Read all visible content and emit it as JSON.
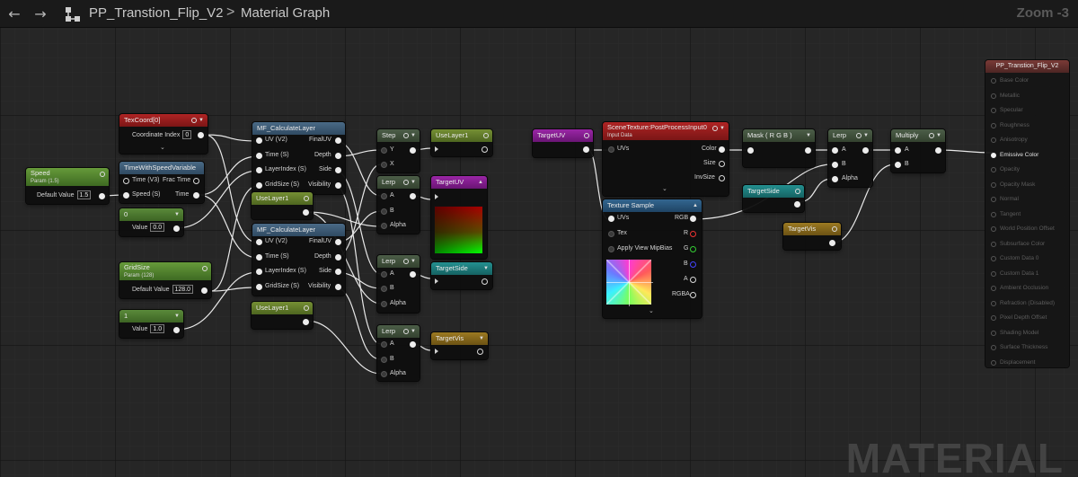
{
  "topbar": {
    "back_icon": "arrow-left-icon",
    "forward_icon": "arrow-right-icon",
    "graph_icon": "node-graph-icon",
    "asset_name": "PP_Transtion_Flip_V2",
    "separator": ">",
    "graph_name": "Material Graph",
    "zoom": "Zoom -3"
  },
  "watermark": "MATERIAL",
  "colors": {
    "texcoord_header": "#9a1e1e",
    "param_header": "#56882f",
    "function_header": "#3e5a74",
    "math_header": "#3c4d3a",
    "uselayer_header": "#5e7a2a",
    "targetuv_header": "#8a1f95",
    "scenetexture_header": "#a01e1e",
    "texturesample_header": "#2b5778",
    "targetside_header": "#1f7e7e",
    "targetvis_header": "#8a6a1c",
    "result_header": "#7a3a36"
  },
  "nodes": {
    "texcoord": {
      "title": "TexCoord[0]",
      "coord_label": "Coordinate Index",
      "coord_value": "0"
    },
    "speed": {
      "title": "Speed",
      "subtitle": "Param (1.5)",
      "default_label": "Default Value",
      "default_value": "1.5"
    },
    "timespeed": {
      "title": "TimeWithSpeedVariable",
      "in_time": "Time (V3)",
      "in_speed": "Speed (S)",
      "out_frac": "Frac Time",
      "out_time": "Time"
    },
    "const0": {
      "title": "0",
      "value_label": "Value",
      "value": "0.0"
    },
    "gridsize": {
      "title": "GridSize",
      "subtitle": "Param (128)",
      "default_label": "Default Value",
      "default_value": "128.0"
    },
    "const1": {
      "title": "1",
      "value_label": "Value",
      "value": "1.0"
    },
    "mf1": {
      "title": "MF_CalculateLayer",
      "in": [
        "UV (V2)",
        "Time (S)",
        "LayerIndex (S)",
        "GridSize (S)"
      ],
      "out": [
        "FinalUV",
        "Depth",
        "Side",
        "Visibility"
      ]
    },
    "mf2": {
      "title": "MF_CalculateLayer",
      "in": [
        "UV (V2)",
        "Time (S)",
        "LayerIndex (S)",
        "GridSize (S)"
      ],
      "out": [
        "FinalUV",
        "Depth",
        "Side",
        "Visibility"
      ]
    },
    "uselayer_a": {
      "title": "UseLayer1"
    },
    "uselayer_b": {
      "title": "UseLayer1"
    },
    "uselayer_c": {
      "title": "UseLayer1"
    },
    "step": {
      "title": "Step",
      "in": [
        "Y",
        "X"
      ]
    },
    "lerp1": {
      "title": "Lerp",
      "in": [
        "A",
        "B",
        "Alpha"
      ]
    },
    "lerp2": {
      "title": "Lerp",
      "in": [
        "A",
        "B",
        "Alpha"
      ]
    },
    "lerp3": {
      "title": "Lerp",
      "in": [
        "A",
        "B",
        "Alpha"
      ]
    },
    "targetuv_out": {
      "title": "TargetUV"
    },
    "targetside_out": {
      "title": "TargetSide"
    },
    "targetvis_out": {
      "title": "TargetVis"
    },
    "targetuv_in": {
      "title": "TargetUV"
    },
    "scenetexture": {
      "title": "SceneTexture:PostProcessInput0",
      "subtitle": "Input Data",
      "in_uvs": "UVs",
      "out": [
        "Color",
        "Size",
        "InvSize"
      ]
    },
    "texturesample": {
      "title": "Texture Sample",
      "in": [
        "UVs",
        "Tex",
        "Apply View MipBias"
      ],
      "out": [
        "RGB",
        "R",
        "G",
        "B",
        "A",
        "RGBA"
      ]
    },
    "mask": {
      "title": "Mask ( R G B )"
    },
    "lerp4": {
      "title": "Lerp",
      "in": [
        "A",
        "B",
        "Alpha"
      ]
    },
    "multiply": {
      "title": "Multiply",
      "in": [
        "A",
        "B"
      ]
    },
    "targetside_in": {
      "title": "TargetSide"
    },
    "targetvis_in": {
      "title": "TargetVis"
    }
  },
  "result": {
    "title": "PP_Transtion_Flip_V2",
    "inputs": [
      {
        "label": "Base Color",
        "active": false
      },
      {
        "label": "Metallic",
        "active": false
      },
      {
        "label": "Specular",
        "active": false
      },
      {
        "label": "Roughness",
        "active": false
      },
      {
        "label": "Anisotropy",
        "active": false
      },
      {
        "label": "Emissive Color",
        "active": true
      },
      {
        "label": "Opacity",
        "active": false
      },
      {
        "label": "Opacity Mask",
        "active": false
      },
      {
        "label": "Normal",
        "active": false
      },
      {
        "label": "Tangent",
        "active": false
      },
      {
        "label": "World Position Offset",
        "active": false
      },
      {
        "label": "Subsurface Color",
        "active": false
      },
      {
        "label": "Custom Data 0",
        "active": false
      },
      {
        "label": "Custom Data 1",
        "active": false
      },
      {
        "label": "Ambient Occlusion",
        "active": false
      },
      {
        "label": "Refraction (Disabled)",
        "active": false
      },
      {
        "label": "Pixel Depth Offset",
        "active": false
      },
      {
        "label": "Shading Model",
        "active": false
      },
      {
        "label": "Surface Thickness",
        "active": false
      },
      {
        "label": "Displacement",
        "active": false
      }
    ]
  }
}
